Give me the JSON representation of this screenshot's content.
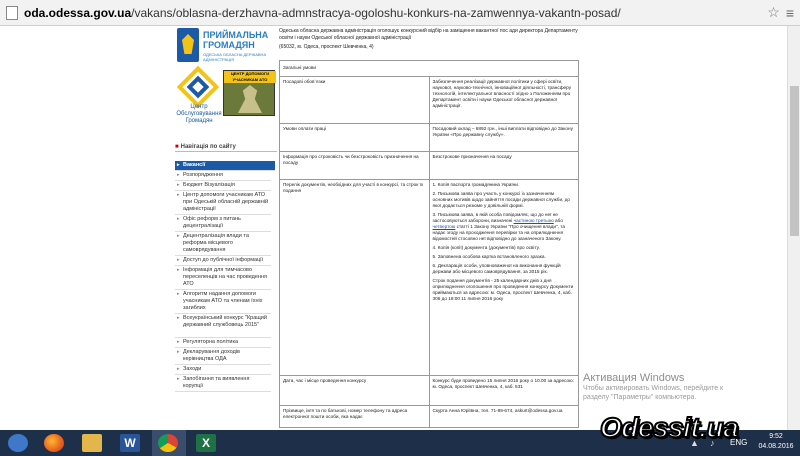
{
  "browser": {
    "url_host": "oda.odessa.gov.ua",
    "url_path": "/vakans/oblasna-derzhavna-admnstracya-ogoloshu-konkurs-na-zamwennya-vakantn-posad/"
  },
  "sidebar": {
    "logo_title": "ПРИЙМАЛЬНА ГРОМАДЯН",
    "logo_sub": "ОДЕСЬКА ОБЛАСНА ДЕРЖАВНА АДМІНІСТРАЦІЯ",
    "center_caption": "Центр Обслуговування Громадян",
    "ato_title": "ЦЕНТР ДОПОМОГИ УЧАСНИКАМ АТО",
    "nav_heading": "Навігація по сайту",
    "items": [
      {
        "label": "Вакансії",
        "active": true
      },
      {
        "label": "Розпорядження"
      },
      {
        "label": "Бюджет Візуалізація"
      },
      {
        "label": "Центр допомоги учасникам АТО при Одеській обласній державній адміністрації"
      },
      {
        "label": "Офіс реформ з питань децентралізації"
      },
      {
        "label": "Децентралізація влади та реформа місцевого самоврядування"
      },
      {
        "label": "Доступ до публічної інформації"
      },
      {
        "label": "Інформація для тимчасово переселенців на час проведення АТО"
      },
      {
        "label": "Алгоритм надання допомоги учасникам АТО та членам їхніх загиблих"
      },
      {
        "label": "Всеукраїнський конкурс \"Кращий державний службовець 2015\""
      },
      {
        "label": "Регуляторна політика"
      },
      {
        "label": "Декларування доходів керівництва ОДА"
      },
      {
        "label": "Заходи"
      },
      {
        "label": "Запобігання та виявлення корупції"
      }
    ]
  },
  "content": {
    "lead": "Одеська обласна державна адміністрація оголошує конкурсний відбір на заміщення вакантної пос ади директора Департаменту освіти і науки Одеської обласної державної адміністрації",
    "address": "(65032, м. Одеса, проспект Шевченка, 4)",
    "general": "Загальні умови",
    "rows": [
      {
        "left": "Посадові обов`язки",
        "right": "Забезпечення реалізації державної політики у сфері освіти, наукової, науково-технічної, інноваційної діяльності, трансферу технологій, інтелектуальної власності згідно з Положенням про Департамент освіти і науки Одеської обласної державної адміністрації."
      },
      {
        "left": "Умови оплати праці",
        "right": "Посадовий оклад – 6892 грн., інші виплати відповідно до Закону України «Про державну службу»."
      },
      {
        "left": "Інформація про строковість чи безстроковість призначення на посаду",
        "right": "Безстрокове призначення на посаду"
      },
      {
        "left": "Перелік документів, необхідних для участі в конкурсі, та строк їх подання"
      },
      {
        "left": "Дата, час і місце проведення конкурсу",
        "right": "Конкурс буде проведено 15 липня 2016 року о 10.00 за адресою: м. Одеса, проспект Шевченка, 4, каб. 531"
      },
      {
        "left": "Прізвище, ім'я та по батькові, номер телефону та адреса електронної пошти особи, яка надає",
        "right": "Скурта Анна Юріївна, тел. 71-89-674, askurt@odessa.gov.ua"
      }
    ],
    "docs": {
      "p1": "1. Копія паспорта громадянина України.",
      "p2": "2. Письмова заява про участь у конкурсі із зазначенням основних мотивів щодо зайняття посади державної служби, до якої додається резюме у довільній формі.",
      "p3a": "3. Письмова заява, в якій особа повідомляє, що до неї не застосовуються заборони, визначені ",
      "p3link1": "частиною третьою",
      "p3b": " або ",
      "p3link2": "четвертою",
      "p3c": " статті 1 Закону України \"Про очищення влади\", та надає згоду на проходження перевірки та на оприлюднення відомостей стосовно неї відповідно до зазначеного Закону.",
      "p4": "4. Копія (копії) документа (документів) про освіту.",
      "p5": "5. Заповнена особова картка встановленого зразка.",
      "p6": "6. Декларація особи, уповноваженої на виконання функцій держави або місцевого самоврядування, за 2015 рік.",
      "p7": "Строк подання документів - 25 календарних днів з дня оприлюднення оголошення про проведення конкурсу Документи приймаються за адресою: м. Одеса, проспект Шевченка, 4, каб. 306 до 18:00 11 липня 2016 року"
    }
  },
  "watermark": {
    "title": "Активация Windows",
    "line1": "Чтобы активировать Windows, перейдите к",
    "line2": "разделу \"Параметры\" компьютера."
  },
  "taskbar": {
    "lang": "ENG",
    "time": "9:52",
    "date": "04.08.2016",
    "word_letter": "W",
    "excel_letter": "X"
  },
  "badge": "Odessit.ua"
}
